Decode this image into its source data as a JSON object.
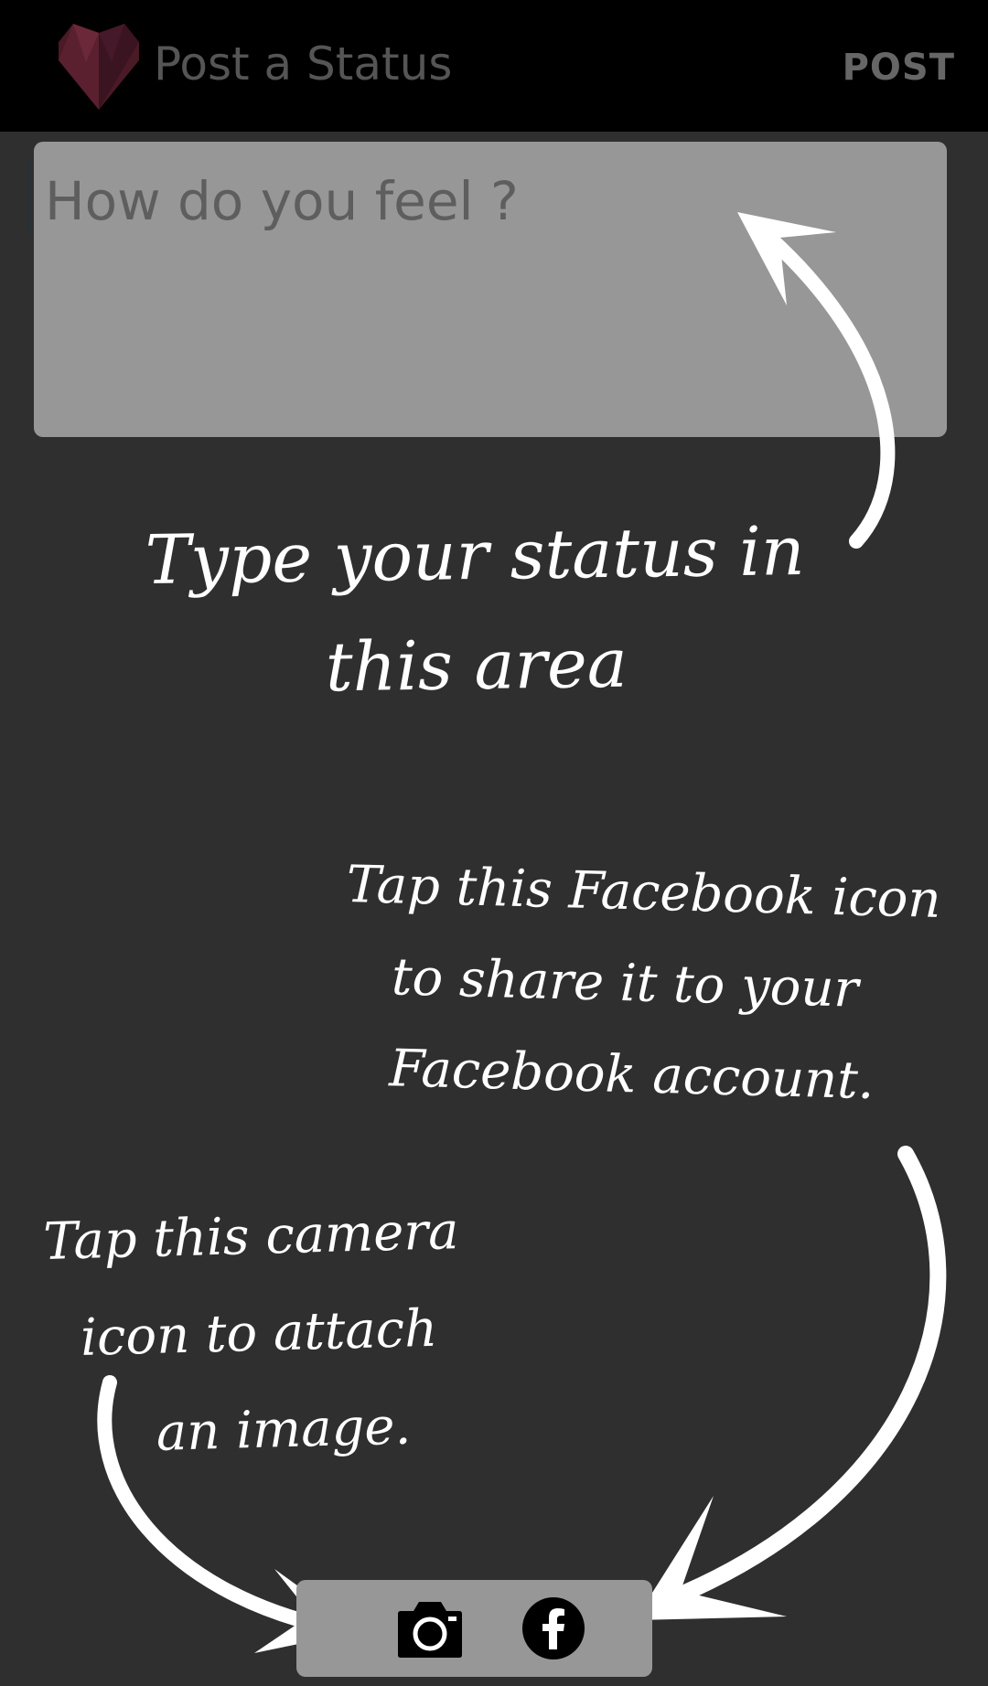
{
  "app_bar": {
    "title": "Post a Status",
    "post_label": "POST",
    "icon": "heart-logo-icon",
    "icon_color": "#4a1a26"
  },
  "status_input": {
    "placeholder": "How do you feel ?"
  },
  "hints": {
    "status": [
      "Type your status in",
      "this area"
    ],
    "facebook": [
      "Tap this Facebook icon",
      "to share it to your",
      "Facebook account."
    ],
    "camera": [
      "Tap this camera",
      "icon to attach",
      "an image."
    ]
  },
  "bottom_bar": {
    "camera_icon": "camera-icon",
    "facebook_icon": "facebook-icon"
  },
  "colors": {
    "app_bar_bg": "#000000",
    "screen_bg": "#2f2f2f",
    "overlay_panel": "#979797",
    "hint_text": "#ffffff"
  }
}
